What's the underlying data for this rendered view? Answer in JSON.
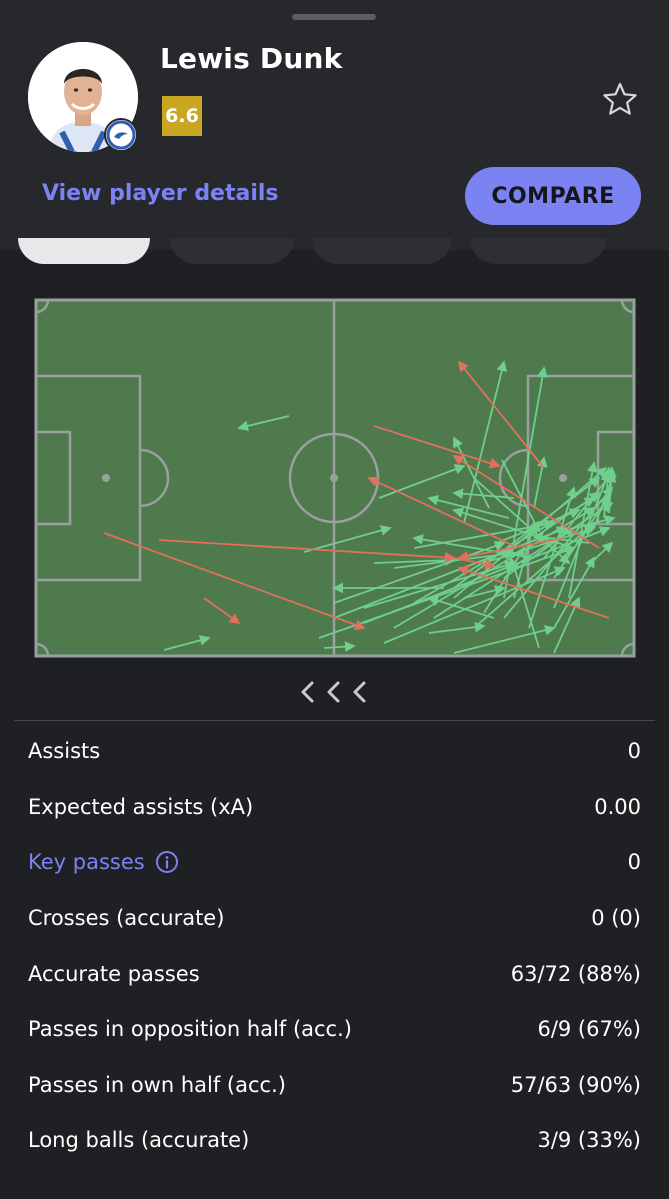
{
  "player": {
    "name": "Lewis Dunk",
    "rating": "6.6",
    "details_link": "View player details",
    "compare_label": "COMPARE"
  },
  "colors": {
    "accent": "#7b83f2",
    "rating": "#c9a723",
    "pitch": "#4f7a4e",
    "accurate_pass": "#6fcf8c",
    "inaccurate_pass": "#e2705a"
  },
  "icons": {
    "favorite": "star-outline-icon",
    "carousel": "chevron-left-icon",
    "info": "info-icon"
  },
  "stats": [
    {
      "label": "Assists",
      "value": "0"
    },
    {
      "label": "Expected assists (xA)",
      "value": "0.00"
    },
    {
      "label": "Key passes",
      "value": "0"
    },
    {
      "label": "Crosses (accurate)",
      "value": "0 (0)"
    },
    {
      "label": "Accurate passes",
      "value": "63/72 (88%)"
    },
    {
      "label": "Passes in opposition half (acc.)",
      "value": "6/9 (67%)"
    },
    {
      "label": "Passes in own half (acc.)",
      "value": "57/63 (90%)"
    },
    {
      "label": "Long balls (accurate)",
      "value": "3/9 (33%)"
    }
  ]
}
